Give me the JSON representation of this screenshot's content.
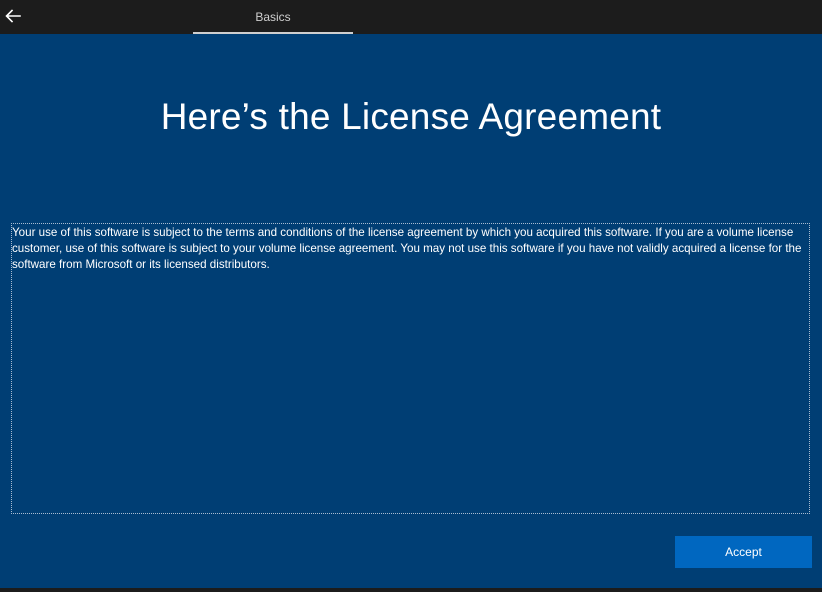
{
  "header": {
    "back_icon": "back-arrow-icon",
    "tab_label": "Basics"
  },
  "main": {
    "title": "Here’s the License Agreement",
    "license_text": "Your use of this software is subject to the terms and conditions of the license agreement by which you acquired this software. If you are a volume license customer, use of this software is subject to your volume license agreement. You may not use this software if you have not validly acquired a license for the software from Microsoft or its licensed distributors.",
    "accept_label": "Accept"
  },
  "colors": {
    "background": "#003e74",
    "topbar": "#1c1c1c",
    "accent_button": "#0067c0"
  }
}
